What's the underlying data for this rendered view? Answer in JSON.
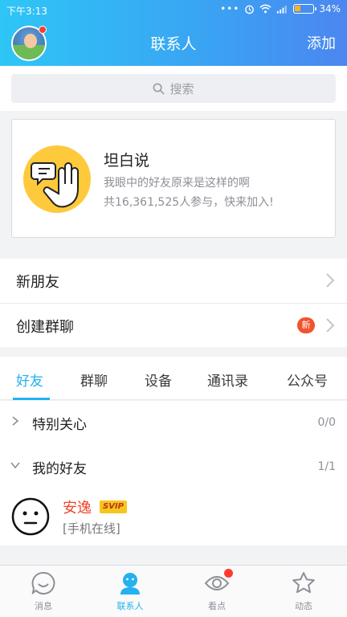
{
  "status": {
    "time": "下午3:13",
    "battery_pct": "34%",
    "battery_level": 0.34
  },
  "header": {
    "title": "联系人",
    "add_label": "添加"
  },
  "search": {
    "placeholder": "搜索"
  },
  "card": {
    "title": "坦白说",
    "subtitle": "我眼中的好友原来是这样的啊",
    "participants": "共16,361,525人参与，快来加入!"
  },
  "menu": {
    "items": [
      {
        "label": "新朋友"
      },
      {
        "label": "创建群聊",
        "badge": "新"
      }
    ]
  },
  "tabs": {
    "items": [
      {
        "label": "好友"
      },
      {
        "label": "群聊"
      },
      {
        "label": "设备"
      },
      {
        "label": "通讯录"
      },
      {
        "label": "公众号"
      }
    ],
    "active": "好友"
  },
  "groups": {
    "items": [
      {
        "name": "特别关心",
        "count": "0/0"
      },
      {
        "name": "我的好友",
        "count": "1/1"
      }
    ]
  },
  "friend": {
    "name": "安逸",
    "badge": "SVIP",
    "status": "[手机在线]"
  },
  "nav": {
    "items": [
      {
        "label": "消息"
      },
      {
        "label": "联系人"
      },
      {
        "label": "看点"
      },
      {
        "label": "动态"
      }
    ],
    "active": "联系人"
  },
  "colors": {
    "accent": "#23b1f0",
    "badge_red": "#f0542d",
    "friend_name": "#f0452c",
    "svip_bg": "#f7c61c"
  }
}
